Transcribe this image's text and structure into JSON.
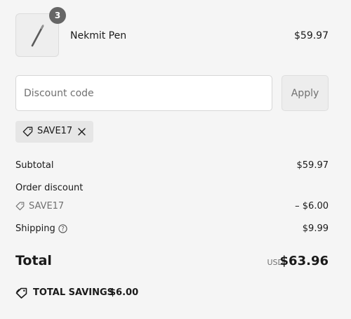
{
  "line_item": {
    "name": "Nekmit Pen",
    "price": "$59.97",
    "quantity": "3",
    "image_icon": "pen-icon"
  },
  "discount": {
    "placeholder": "Discount code",
    "value": "",
    "apply_label": "Apply",
    "applied_code": "SAVE17",
    "chip_icon": "tag-icon",
    "remove_icon": "close-icon"
  },
  "summary": {
    "subtotal_label": "Subtotal",
    "subtotal_value": "$59.97",
    "order_discount_label": "Order discount",
    "discount_code": "SAVE17",
    "discount_value": "– $6.00",
    "shipping_label": "Shipping",
    "shipping_info_icon": "info-icon",
    "shipping_value": "$9.99",
    "total_label": "Total",
    "total_currency": "USD",
    "total_value": "$63.96",
    "savings_label": "TOTAL SAVINGS",
    "savings_value": "$6.00"
  },
  "colors": {
    "background": "#f5f5f5",
    "text": "#1a1a1a",
    "muted_text": "#707070",
    "badge": "#666666",
    "chip_background": "#e6e6e6"
  }
}
